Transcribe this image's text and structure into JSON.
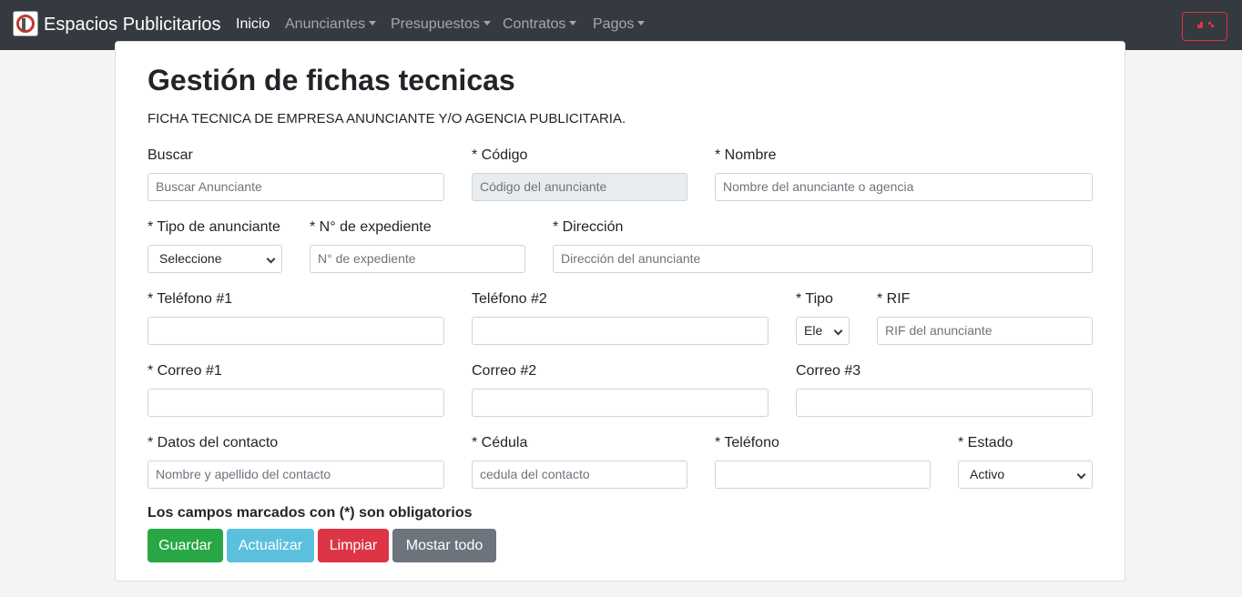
{
  "navbar": {
    "brand": "Espacios Publicitarios",
    "items": [
      {
        "label": "Inicio",
        "active": true,
        "dropdown": false
      },
      {
        "label": "Anunciantes",
        "active": false,
        "dropdown": true
      },
      {
        "label": "Presupuestos",
        "active": false,
        "dropdown": true
      },
      {
        "label": "Contratos",
        "active": false,
        "dropdown": true
      },
      {
        "label": "Pagos",
        "active": false,
        "dropdown": true
      }
    ],
    "user_icon": "user-icon"
  },
  "page": {
    "title": "Gestión de fichas tecnicas",
    "subtitle": "FICHA TECNICA DE EMPRESA ANUNCIANTE Y/O AGENCIA PUBLICITARIA."
  },
  "form": {
    "buscar": {
      "label": "Buscar",
      "placeholder": "Buscar Anunciante"
    },
    "codigo": {
      "label": "* Código",
      "placeholder": "Código del anunciante"
    },
    "nombre": {
      "label": "* Nombre",
      "placeholder": "Nombre del anunciante o agencia"
    },
    "tipo_anunciante": {
      "label": "* Tipo de anunciante",
      "value": "Seleccione"
    },
    "expediente": {
      "label": "* N° de expediente",
      "placeholder": "N° de expediente"
    },
    "direccion": {
      "label": "* Dirección",
      "placeholder": "Dirección del anunciante"
    },
    "telefono1": {
      "label": "* Teléfono #1",
      "placeholder": ""
    },
    "telefono2": {
      "label": "Teléfono #2",
      "placeholder": ""
    },
    "tipo": {
      "label": "* Tipo",
      "value": "Ele"
    },
    "rif": {
      "label": "* RIF",
      "placeholder": "RIF del anunciante"
    },
    "correo1": {
      "label": "* Correo #1",
      "placeholder": ""
    },
    "correo2": {
      "label": "Correo #2",
      "placeholder": ""
    },
    "correo3": {
      "label": "Correo #3",
      "placeholder": ""
    },
    "contacto": {
      "label": "* Datos del contacto",
      "placeholder": "Nombre y apellido del contacto"
    },
    "cedula": {
      "label": "* Cédula",
      "placeholder": "cedula del contacto"
    },
    "telefono": {
      "label": "* Teléfono",
      "placeholder": ""
    },
    "estado": {
      "label": "* Estado",
      "value": "Activo"
    },
    "required_note": "Los campos marcados con (*) son obligatorios"
  },
  "buttons": [
    {
      "label": "Guardar",
      "color": "#28a745"
    },
    {
      "label": "Actualizar",
      "color": "#5bc0de"
    },
    {
      "label": "Limpiar",
      "color": "#dc3545"
    },
    {
      "label": "Mostar todo",
      "color": "#6c757d"
    }
  ]
}
